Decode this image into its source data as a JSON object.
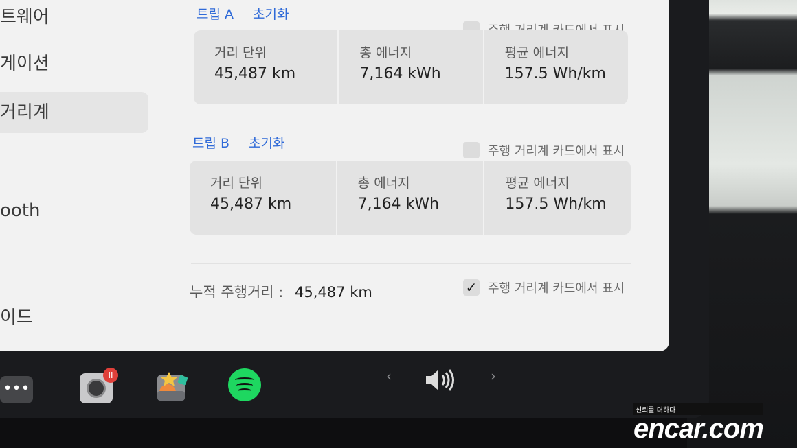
{
  "sidebar": {
    "items": [
      {
        "label": "트웨어"
      },
      {
        "label": "게이션"
      },
      {
        "label": "거리계"
      },
      {
        "label": "ooth"
      },
      {
        "label": "이드"
      }
    ]
  },
  "trip_a": {
    "title": "트립 A",
    "reset": "초기화",
    "show_label": "주행 거리계 카드에서 표시",
    "checked": false,
    "stats": [
      {
        "label": "거리 단위",
        "value": "45,487 km"
      },
      {
        "label": "총 에너지",
        "value": "7,164 kWh"
      },
      {
        "label": "평균 에너지",
        "value": "157.5 Wh/km"
      }
    ]
  },
  "trip_b": {
    "title": "트립 B",
    "reset": "초기화",
    "show_label": "주행 거리계 카드에서 표시",
    "checked": false,
    "stats": [
      {
        "label": "거리 단위",
        "value": "45,487 km"
      },
      {
        "label": "총 에너지",
        "value": "7,164 kWh"
      },
      {
        "label": "평균 에너지",
        "value": "157.5 Wh/km"
      }
    ]
  },
  "odometer": {
    "label": "누적 주행거리 :",
    "value": "45,487 km",
    "show_label": "주행 거리계 카드에서 표시",
    "check_mark": "✓",
    "checked": true
  },
  "dock": {
    "more_icon": "•••",
    "prev_icon": "‹",
    "next_icon": "›",
    "volume_icon": "🔊",
    "rec_badge": "II"
  },
  "watermark": {
    "tagline": "신뢰를 더하다",
    "brand": "encar.com"
  }
}
